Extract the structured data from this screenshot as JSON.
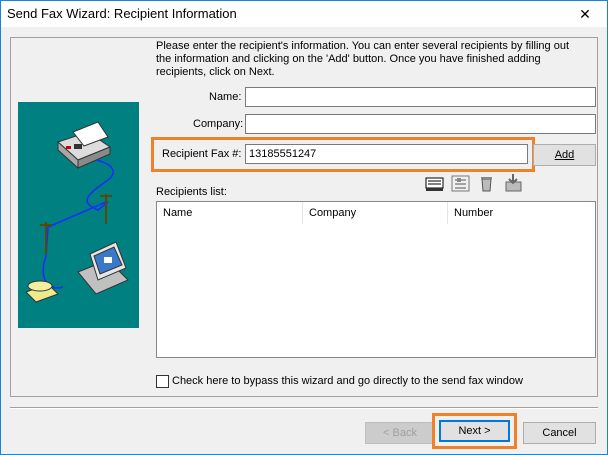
{
  "window": {
    "title": "Send Fax Wizard: Recipient Information",
    "close_glyph": "✕"
  },
  "instructions": "Please enter the recipient's information. You can enter several recipients by filling out the information and clicking  on the 'Add' button. Once you have finished adding recipients, click on Next.",
  "form": {
    "name_label": "Name:",
    "name_value": "",
    "company_label": "Company:",
    "company_value": "",
    "fax_label": "Recipient Fax #:",
    "fax_value": "13185551247",
    "add_label": "Add"
  },
  "toolbar": {
    "icons": [
      "address-book-icon",
      "list-details-icon",
      "delete-recipient-icon",
      "import-recipients-icon"
    ]
  },
  "recipients": {
    "label": "Recipients list:",
    "columns": [
      "Name",
      "Company",
      "Number"
    ],
    "rows": []
  },
  "bypass": {
    "checked": false,
    "label": "Check here to bypass this wizard and go directly to the send fax window"
  },
  "footer": {
    "back_label": "< Back",
    "next_label": "Next >",
    "cancel_label": "Cancel"
  },
  "colors": {
    "highlight": "#f0802a",
    "illustration_bg": "#008080",
    "window_border": "#1883d7"
  }
}
